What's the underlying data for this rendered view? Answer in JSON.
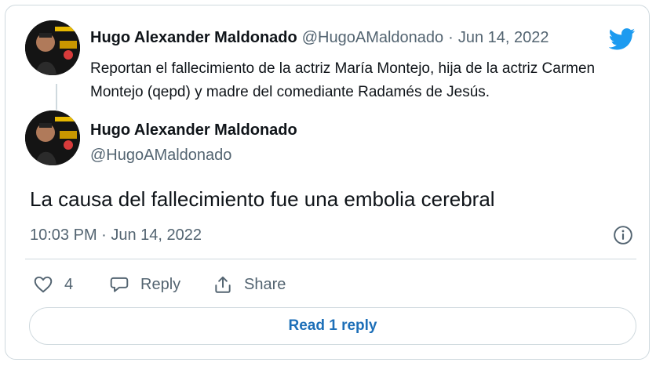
{
  "colors": {
    "brand": "#1d9bf0",
    "link": "#1d6fb8",
    "text": "#0f1419",
    "muted": "#536471",
    "border": "#cfd9de"
  },
  "quoted_tweet": {
    "author_name": "Hugo Alexander Maldonado",
    "handle": "@HugoAMaldonado",
    "separator": "·",
    "date": "Jun 14, 2022",
    "text": "Reportan el fallecimiento de la actriz María Montejo, hija de la actriz Carmen Montejo (qepd) y madre del comediante Radamés de Jesús.",
    "logo_icon": "twitter-bird-icon"
  },
  "main_tweet": {
    "author_name": "Hugo Alexander Maldonado",
    "handle": "@HugoAMaldonado",
    "text": "La causa del fallecimiento fue una embolia cerebral",
    "timestamp": "10:03 PM · Jun 14, 2022",
    "info_icon": "info-icon"
  },
  "actions": {
    "like_icon": "heart-icon",
    "like_count": "4",
    "reply_icon": "reply-icon",
    "reply_label": "Reply",
    "share_icon": "share-icon",
    "share_label": "Share"
  },
  "read_replies_label": "Read 1 reply"
}
